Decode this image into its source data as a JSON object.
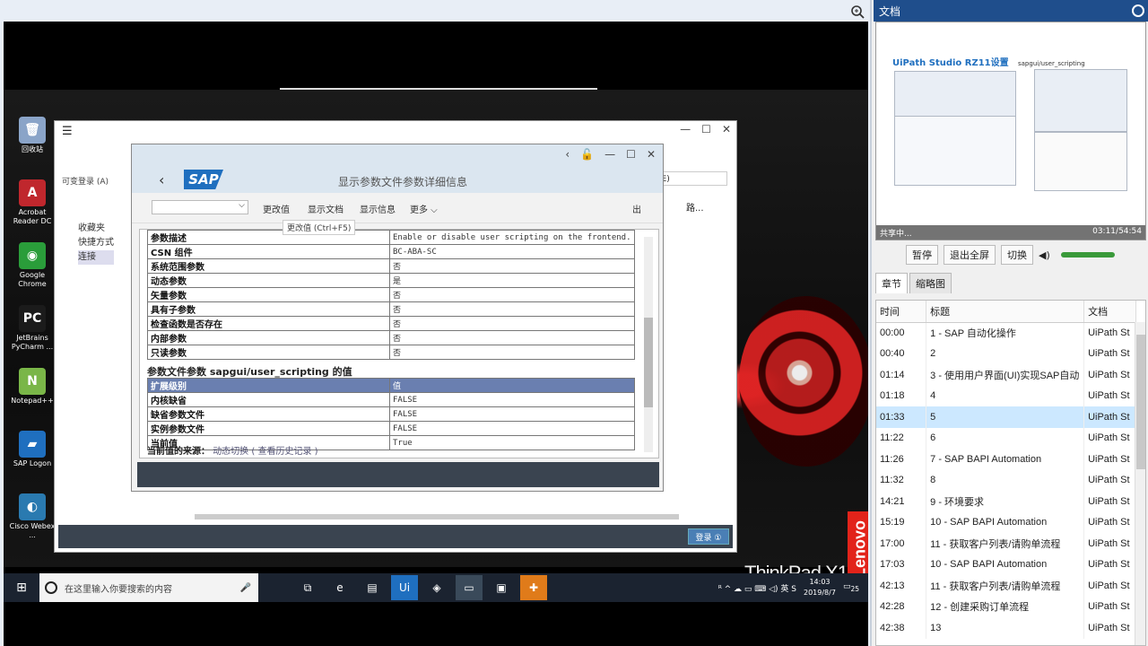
{
  "sap_dialog": {
    "title": "显示参数文件参数详细信息",
    "tools": [
      "更改值",
      "显示文档",
      "显示信息",
      "更多 ⌵"
    ],
    "tooltip": "更改值      (Ctrl+F5)",
    "exit_label": "出",
    "param_rows": [
      [
        "参数描述",
        "Enable or disable user scripting on the frontend."
      ],
      [
        "CSN 组件",
        "BC-ABA-SC"
      ],
      [
        "系统范围参数",
        "否"
      ],
      [
        "动态参数",
        "是"
      ],
      [
        "矢量参数",
        "否"
      ],
      [
        "具有子参数",
        "否"
      ],
      [
        "检查函数是否存在",
        "否"
      ],
      [
        "内部参数",
        "否"
      ],
      [
        "只读参数",
        "否"
      ]
    ],
    "section_title": "参数文件参数 sapgui/user_scripting 的值",
    "value_rows": [
      [
        "扩展级别",
        "值"
      ],
      [
        "内核缺省",
        "FALSE"
      ],
      [
        "缺省参数文件",
        "FALSE"
      ],
      [
        "实例参数文件",
        "FALSE"
      ],
      [
        "当前值",
        "True"
      ]
    ],
    "source_label": "当前值的来源：",
    "source_value": "动态切换",
    "source_link": "( 查看历史记录 )"
  },
  "sap_outer": {
    "menu": "可变登录 (A)",
    "right_field": "视图(E)",
    "nav": [
      "收藏夹",
      "快捷方式",
      "连接"
    ],
    "right_col": "路...",
    "ok": "登录 ①"
  },
  "desktop_icons": [
    {
      "label": "回收站",
      "color": "#8aa4c8",
      "glyph": "🗑"
    },
    {
      "label": "Acrobat Reader DC",
      "color": "#c0272d",
      "glyph": "A"
    },
    {
      "label": "Google Chrome",
      "color": "#2a9d3a",
      "glyph": "◉"
    },
    {
      "label": "JetBrains PyCharm ...",
      "color": "#1b1b1b",
      "glyph": "PC"
    },
    {
      "label": "Notepad++",
      "color": "#7ab648",
      "glyph": "N"
    },
    {
      "label": "SAP Logon",
      "color": "#1f6fbf",
      "glyph": "▰"
    },
    {
      "label": "Cisco Webex ...",
      "color": "#2a7ab0",
      "glyph": "◐"
    }
  ],
  "taskbar": {
    "search_placeholder": "在这里输入你要搜索的内容",
    "apps": [
      "⧉",
      "e",
      "▤",
      "Ui",
      "◈",
      "▭",
      "▣",
      "✚"
    ],
    "tray": "ᴿ  ^  ☁  ▭  ⌨  ◁)  英  S",
    "time": "14:03",
    "date": "2019/8/7",
    "notif": "25"
  },
  "desktop_brand": {
    "thinkpad": "ThinkPad X1",
    "lenovo": "Lenovo"
  },
  "side": {
    "doc_title": "文档",
    "preview_title": "UiPath Studio RZ11设置",
    "preview_sub": "sapgui/user_scripting",
    "status_left": "共享中...",
    "status_right": "03:11/54:54",
    "controls": [
      "暂停",
      "退出全屏",
      "切换"
    ],
    "tabs": [
      "章节",
      "缩略图"
    ],
    "columns": [
      "时间",
      "标题",
      "文档"
    ],
    "chapters": [
      [
        "00:00",
        "1 - SAP 自动化操作",
        "UiPath St"
      ],
      [
        "00:40",
        "2",
        "UiPath St"
      ],
      [
        "01:14",
        "3 - 使用用户界面(UI)实现SAP自动",
        "UiPath St"
      ],
      [
        "01:18",
        "4",
        "UiPath St"
      ],
      [
        "01:33",
        "5",
        "UiPath St"
      ],
      [
        "11:22",
        "6",
        "UiPath St"
      ],
      [
        "11:26",
        "7 - SAP BAPI Automation",
        "UiPath St"
      ],
      [
        "11:32",
        "8",
        "UiPath St"
      ],
      [
        "14:21",
        "9 - 环境要求",
        "UiPath St"
      ],
      [
        "15:19",
        "10 - SAP BAPI Automation",
        "UiPath St"
      ],
      [
        "17:00",
        "11 - 获取客户列表/请购单流程",
        "UiPath St"
      ],
      [
        "17:03",
        "10 - SAP BAPI Automation",
        "UiPath St"
      ],
      [
        "42:13",
        "11 - 获取客户列表/请购单流程",
        "UiPath St"
      ],
      [
        "42:28",
        "12 - 创建采购订单流程",
        "UiPath St"
      ],
      [
        "42:38",
        "13",
        "UiPath St"
      ]
    ],
    "highlight_index": 4
  }
}
